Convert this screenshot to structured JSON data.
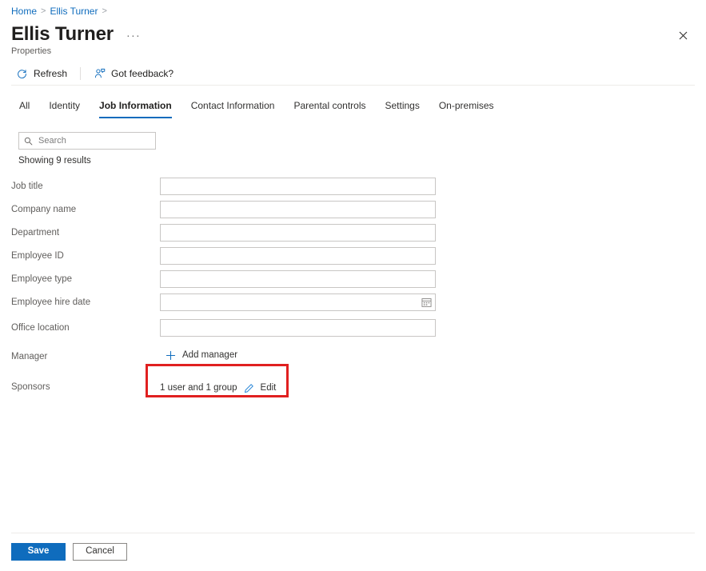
{
  "breadcrumb": {
    "items": [
      {
        "label": "Home"
      },
      {
        "label": "Ellis Turner"
      }
    ],
    "separator": ">"
  },
  "header": {
    "title": "Ellis Turner",
    "subtitle": "Properties",
    "more_actions": "···",
    "close_icon": "close-icon"
  },
  "commandbar": {
    "refresh": {
      "label": "Refresh",
      "icon": "refresh-icon"
    },
    "feedback": {
      "label": "Got feedback?",
      "icon": "feedback-person-icon"
    }
  },
  "tabs": [
    {
      "label": "All",
      "active": false
    },
    {
      "label": "Identity",
      "active": false
    },
    {
      "label": "Job Information",
      "active": true
    },
    {
      "label": "Contact Information",
      "active": false
    },
    {
      "label": "Parental controls",
      "active": false
    },
    {
      "label": "Settings",
      "active": false
    },
    {
      "label": "On-premises",
      "active": false
    }
  ],
  "search": {
    "placeholder": "Search",
    "value": "",
    "icon": "search-icon"
  },
  "results_text": "Showing 9 results",
  "fields": {
    "job_title": {
      "label": "Job title",
      "value": ""
    },
    "company_name": {
      "label": "Company name",
      "value": ""
    },
    "department": {
      "label": "Department",
      "value": ""
    },
    "employee_id": {
      "label": "Employee ID",
      "value": ""
    },
    "employee_type": {
      "label": "Employee type",
      "value": ""
    },
    "employee_hire_date": {
      "label": "Employee hire date",
      "value": "",
      "icon": "calendar-icon"
    },
    "office_location": {
      "label": "Office location",
      "value": ""
    },
    "manager": {
      "label": "Manager",
      "action_label": "Add manager",
      "action_icon": "plus-icon"
    },
    "sponsors": {
      "label": "Sponsors",
      "value_text": "1 user and 1 group",
      "edit_label": "Edit",
      "edit_icon": "pencil-icon"
    }
  },
  "footer": {
    "save_label": "Save",
    "cancel_label": "Cancel"
  },
  "colors": {
    "accent": "#0f6cbd",
    "link": "#0f6cbd",
    "highlight": "#e02020",
    "pencil": "#2b88d8"
  }
}
